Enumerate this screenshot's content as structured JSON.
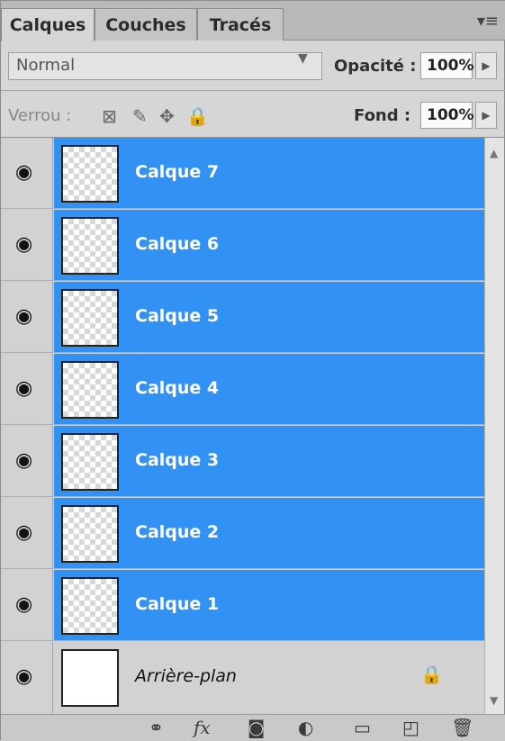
{
  "tabs": [
    {
      "label": "Calques"
    },
    {
      "label": "Couches"
    },
    {
      "label": "Tracés"
    }
  ],
  "blend": {
    "mode": "Normal",
    "opacity_label": "Opacité :",
    "opacity_value": "100%"
  },
  "lock": {
    "label": "Verrou :",
    "fill_label": "Fond :",
    "fill_value": "100%"
  },
  "layers": [
    {
      "name": "Calque 7",
      "selected": true
    },
    {
      "name": "Calque 6",
      "selected": true
    },
    {
      "name": "Calque 5",
      "selected": true
    },
    {
      "name": "Calque 4",
      "selected": true
    },
    {
      "name": "Calque 3",
      "selected": true
    },
    {
      "name": "Calque 2",
      "selected": true
    },
    {
      "name": "Calque 1",
      "selected": true
    },
    {
      "name": "Arrière-plan",
      "selected": false,
      "locked": true
    }
  ],
  "colors": {
    "selection": "#3292f3",
    "panel": "#d6d6d6"
  },
  "icons": {
    "panel_menu": "panel-menu-icon",
    "visibility": "eye-icon",
    "bottom": [
      "link-layers-icon",
      "fx-icon",
      "add-mask-icon",
      "adjustment-layer-icon",
      "new-group-icon",
      "new-layer-icon",
      "trash-icon"
    ]
  }
}
